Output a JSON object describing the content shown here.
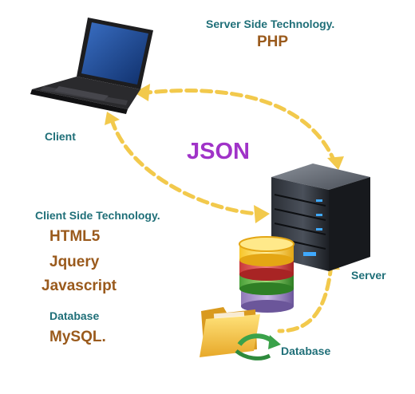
{
  "labels": {
    "server_tech_title": "Server Side Technology.",
    "server_tech_value": "PHP",
    "client": "Client",
    "json": "JSON",
    "client_tech_title": "Client Side Technology.",
    "client_tech_items": [
      "HTML5",
      "Jquery",
      "Javascript"
    ],
    "database_title": "Database",
    "database_value": "MySQL.",
    "server": "Server",
    "database": "Database"
  },
  "icons": {
    "laptop": "laptop-icon",
    "server": "server-icon",
    "database": "database-icon",
    "folder": "folder-icon"
  },
  "colors": {
    "arrow": "#f2c94c",
    "teal_text": "#1f6f78",
    "brown_text": "#9a5a1c",
    "json_text": "#a033c8"
  }
}
